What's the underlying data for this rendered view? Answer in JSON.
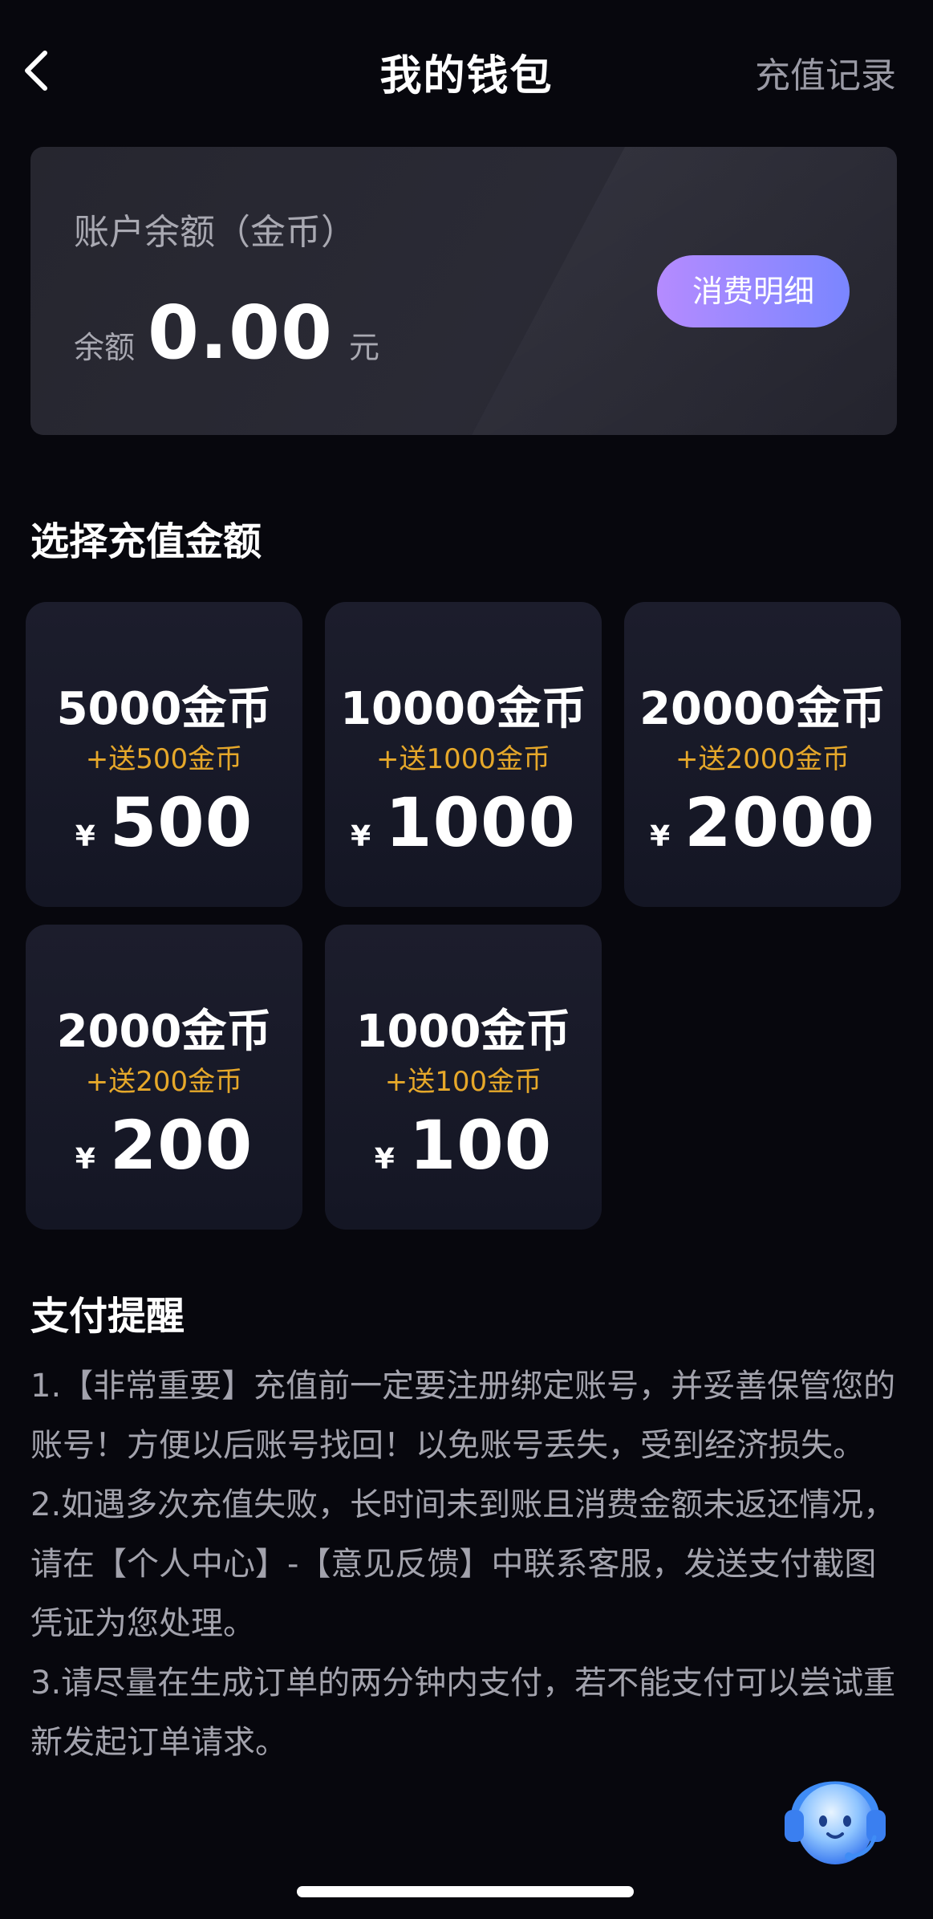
{
  "header": {
    "title": "我的钱包",
    "history_label": "充值记录"
  },
  "balance": {
    "label": "账户余额（金币）",
    "prefix": "余额",
    "amount": "0.00",
    "unit": "元",
    "detail_button": "消费明细"
  },
  "recharge": {
    "title": "选择充值金额",
    "currency_symbol": "¥",
    "options": [
      {
        "coins": "5000金币",
        "bonus": "+送500金币",
        "price": "500"
      },
      {
        "coins": "10000金币",
        "bonus": "+送1000金币",
        "price": "1000"
      },
      {
        "coins": "20000金币",
        "bonus": "+送2000金币",
        "price": "2000"
      },
      {
        "coins": "2000金币",
        "bonus": "+送200金币",
        "price": "200"
      },
      {
        "coins": "1000金币",
        "bonus": "+送100金币",
        "price": "100"
      }
    ]
  },
  "notice": {
    "title": "支付提醒",
    "items": [
      "1.【非常重要】充值前一定要注册绑定账号，并妥善保管您的账号！方便以后账号找回！以免账号丢失，受到经济损失。",
      " 2.如遇多次充值失败，长时间未到账且消费金额未返还情况，请在【个人中心】-【意见反馈】中联系客服，发送支付截图凭证为您处理。",
      " 3.请尽量在生成订单的两分钟内支付，若不能支付可以尝试重新发起订单请求。"
    ]
  },
  "icons": {
    "back": "chevron-left-icon",
    "support": "customer-service-icon"
  },
  "colors": {
    "background": "#07070d",
    "accent_start": "#b58bff",
    "accent_end": "#7a86ff",
    "bonus": "#e6a82a"
  }
}
